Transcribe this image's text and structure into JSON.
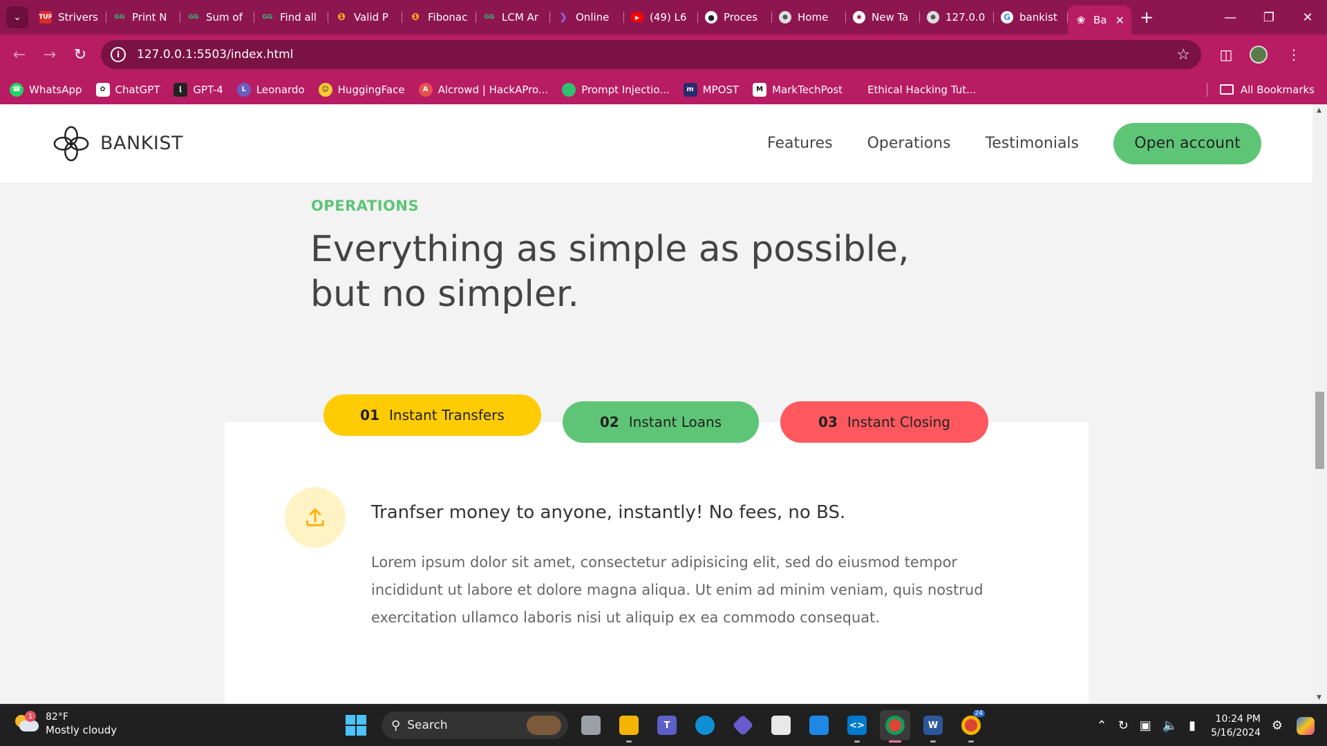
{
  "browser": {
    "tabs": [
      {
        "title": "Strivers",
        "favicon": "tuf-icon",
        "color": "#d72d2d"
      },
      {
        "title": "Print N",
        "favicon": "gfg-icon",
        "color": "#2f8d46"
      },
      {
        "title": "Sum of",
        "favicon": "gfg-icon",
        "color": "#2f8d46"
      },
      {
        "title": "Find all",
        "favicon": "gfg-icon",
        "color": "#2f8d46"
      },
      {
        "title": "Valid P",
        "favicon": "leetcode-icon",
        "color": "#ffa116"
      },
      {
        "title": "Fibonac",
        "favicon": "leetcode-icon",
        "color": "#ffa116"
      },
      {
        "title": "LCM Ar",
        "favicon": "gfg-icon",
        "color": "#2f8d46"
      },
      {
        "title": "Online",
        "favicon": "compiler-icon",
        "color": "#6a3cc9"
      },
      {
        "title": "(49) L6",
        "favicon": "youtube-icon",
        "color": "#ff0000"
      },
      {
        "title": "Proces",
        "favicon": "github-icon",
        "color": "#222222"
      },
      {
        "title": "Home",
        "favicon": "globe-icon",
        "color": "#777777"
      },
      {
        "title": "New Ta",
        "favicon": "chrome-icon",
        "color": "#777777"
      },
      {
        "title": "127.0.0",
        "favicon": "globe-icon",
        "color": "#777777"
      },
      {
        "title": "bankist",
        "favicon": "google-icon",
        "color": "#4285f4"
      }
    ],
    "active_tab": {
      "title": "Ba",
      "favicon": "bankist-icon"
    },
    "new_tab": "+",
    "url": "127.0.0.1:5503/index.html",
    "bookmarks": [
      {
        "label": "WhatsApp",
        "icon": "whatsapp-icon",
        "color": "#25d366"
      },
      {
        "label": "ChatGPT",
        "icon": "chatgpt-icon",
        "color": "#555555"
      },
      {
        "label": "GPT-4",
        "icon": "gpt4-icon",
        "color": "#222222"
      },
      {
        "label": "Leonardo",
        "icon": "leonardo-icon",
        "color": "#6b5fbf"
      },
      {
        "label": "HuggingFace",
        "icon": "huggingface-icon",
        "color": "#ffcc33"
      },
      {
        "label": "Alcrowd | HackAPro...",
        "icon": "alcrowd-icon",
        "color": "#e84f4f"
      },
      {
        "label": "Prompt Injectio...",
        "icon": "prompt-icon",
        "color": "#2fbf71"
      },
      {
        "label": "MPOST",
        "icon": "mpost-icon",
        "color": "#2a2a6e"
      },
      {
        "label": "MarkTechPost",
        "icon": "marktechpost-icon",
        "color": "#111111"
      },
      {
        "label": "Ethical Hacking Tut...",
        "icon": "",
        "color": "#b81c63"
      }
    ],
    "all_bookmarks": "All Bookmarks"
  },
  "site": {
    "logo_text": "BANKIST",
    "nav": [
      "Features",
      "Operations",
      "Testimonials"
    ],
    "cta": "Open account"
  },
  "section": {
    "tag": "OPERATIONS",
    "title": "Everything as simple as possible, but no simpler."
  },
  "operations": {
    "tabs": [
      {
        "num": "01",
        "label": "Instant Transfers",
        "color": "#ffcb03"
      },
      {
        "num": "02",
        "label": "Instant Loans",
        "color": "#5ec576"
      },
      {
        "num": "03",
        "label": "Instant Closing",
        "color": "#ff585f"
      }
    ],
    "active": {
      "icon": "upload-icon",
      "heading": "Tranfser money to anyone, instantly! No fees, no BS.",
      "text": "Lorem ipsum dolor sit amet, consectetur adipisicing elit, sed do eiusmod tempor incididunt ut labore et dolore magna aliqua. Ut enim ad minim veniam, quis nostrud exercitation ullamco laboris nisi ut aliquip ex ea commodo consequat."
    }
  },
  "taskbar": {
    "weather": {
      "temp": "82°F",
      "condition": "Mostly cloudy",
      "badge": "1"
    },
    "search_placeholder": "Search",
    "apps": [
      {
        "name": "task-view-icon",
        "color": "#9aa0a6",
        "label": ""
      },
      {
        "name": "file-explorer-icon",
        "color": "#f4b400",
        "label": ""
      },
      {
        "name": "teams-icon",
        "color": "#5b5fc7",
        "label": "T"
      },
      {
        "name": "edge-icon",
        "color": "#0f8fd6",
        "label": ""
      },
      {
        "name": "copilot-app-icon",
        "color": "#6a5acd",
        "label": ""
      },
      {
        "name": "store-icon",
        "color": "#e8e8e8",
        "label": ""
      },
      {
        "name": "mail-icon",
        "color": "#1e88e5",
        "label": ""
      },
      {
        "name": "vscode-icon",
        "color": "#007acc",
        "label": "<>"
      },
      {
        "name": "chrome-icon",
        "color": "#db4437",
        "label": ""
      },
      {
        "name": "word-icon",
        "color": "#2b579a",
        "label": "W"
      },
      {
        "name": "chrome-profile-icon",
        "color": "#0f9d58",
        "label": ""
      }
    ],
    "chrome_badge": "24",
    "time": "10:24 PM",
    "date": "5/16/2024"
  },
  "colors": {
    "browser_dark": "#8e1650",
    "browser_mid": "#b81c63",
    "green": "#5ec576",
    "yellow": "#ffcb03",
    "red": "#ff585f"
  }
}
